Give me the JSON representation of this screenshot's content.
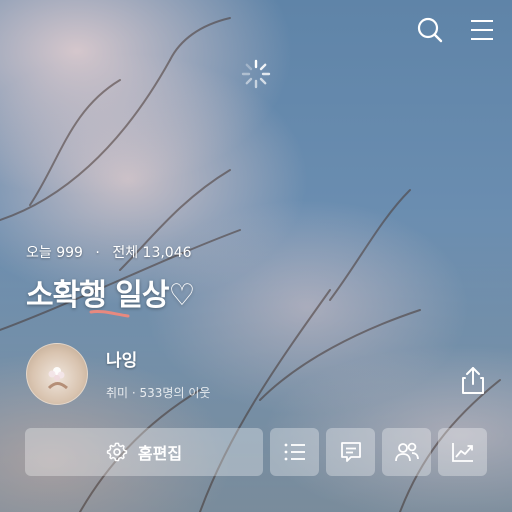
{
  "header": {
    "search_icon": "search-icon",
    "menu_icon": "hamburger-menu-icon"
  },
  "blog": {
    "stats": {
      "today_label": "오늘",
      "today_count": "999",
      "separator": "·",
      "total_label": "전체",
      "total_count": "13,046"
    },
    "title": "소확행 일상♡"
  },
  "profile": {
    "name": "나잉",
    "meta": "취미 · 533명의 이웃"
  },
  "actions": {
    "home_edit_label": "홈편집",
    "list_icon": "list-icon",
    "guestbook_icon": "comment-icon",
    "neighbors_icon": "people-icon",
    "stats_icon": "trending-up-icon"
  },
  "colors": {
    "sky": "#6a8db0",
    "blossom": "#e6d2d2",
    "underline": "#e8897f"
  }
}
